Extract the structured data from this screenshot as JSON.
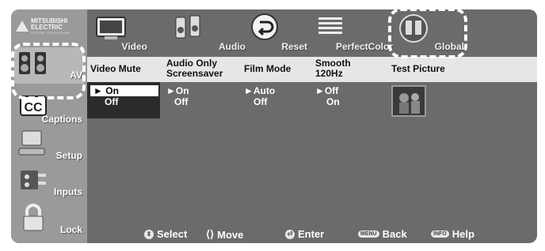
{
  "brand": {
    "name": "MITSUBISHI ELECTRIC",
    "tagline": "DIGITAL TELEVISION"
  },
  "sidebar": {
    "items": [
      {
        "label": "AV",
        "icon": "speakers-icon"
      },
      {
        "label": "Captions",
        "icon": "cc-icon"
      },
      {
        "label": "Setup",
        "icon": "monitor-keyboard-icon"
      },
      {
        "label": "Inputs",
        "icon": "plug-icon"
      },
      {
        "label": "Lock",
        "icon": "padlock-icon"
      }
    ]
  },
  "topmenu": {
    "items": [
      {
        "label": "Video",
        "icon": "tv-icon"
      },
      {
        "label": "Audio",
        "icon": "speaker-pair-icon"
      },
      {
        "label": "Reset",
        "icon": "reset-arrow-icon"
      },
      {
        "label": "PerfectColor",
        "icon": "color-bars-icon"
      },
      {
        "label": "Global",
        "icon": "globe-speakers-icon"
      }
    ],
    "selected": "Global"
  },
  "columns": [
    {
      "title": "Video Mute",
      "options": [
        "On",
        "Off"
      ],
      "selected": "On"
    },
    {
      "title": "Audio Only Screensaver",
      "title_l1": "Audio Only",
      "title_l2": "Screensaver",
      "options": [
        "On",
        "Off"
      ],
      "selected": "On"
    },
    {
      "title": "Film Mode",
      "options": [
        "Auto",
        "Off"
      ],
      "selected": "Auto"
    },
    {
      "title": "Smooth 120Hz",
      "title_l1": "Smooth",
      "title_l2": "120Hz",
      "options": [
        "Off",
        "On"
      ],
      "selected": "Off"
    },
    {
      "title": "Test Picture",
      "options": [],
      "selected": ""
    }
  ],
  "selector_glyph": "►",
  "bottom_hints": [
    {
      "label": "Select",
      "key": "updown-icon"
    },
    {
      "label": "Move",
      "key": "arrows-icon"
    },
    {
      "label": "Enter",
      "key": "enter-icon"
    },
    {
      "label": "Back",
      "key": "MENU"
    },
    {
      "label": "Help",
      "key": "INFO"
    }
  ],
  "colors": {
    "background": "#6b6b6b",
    "sidebar": "#9a9a9a",
    "header": "#e6e6e6",
    "highlight": "#ffffff"
  }
}
